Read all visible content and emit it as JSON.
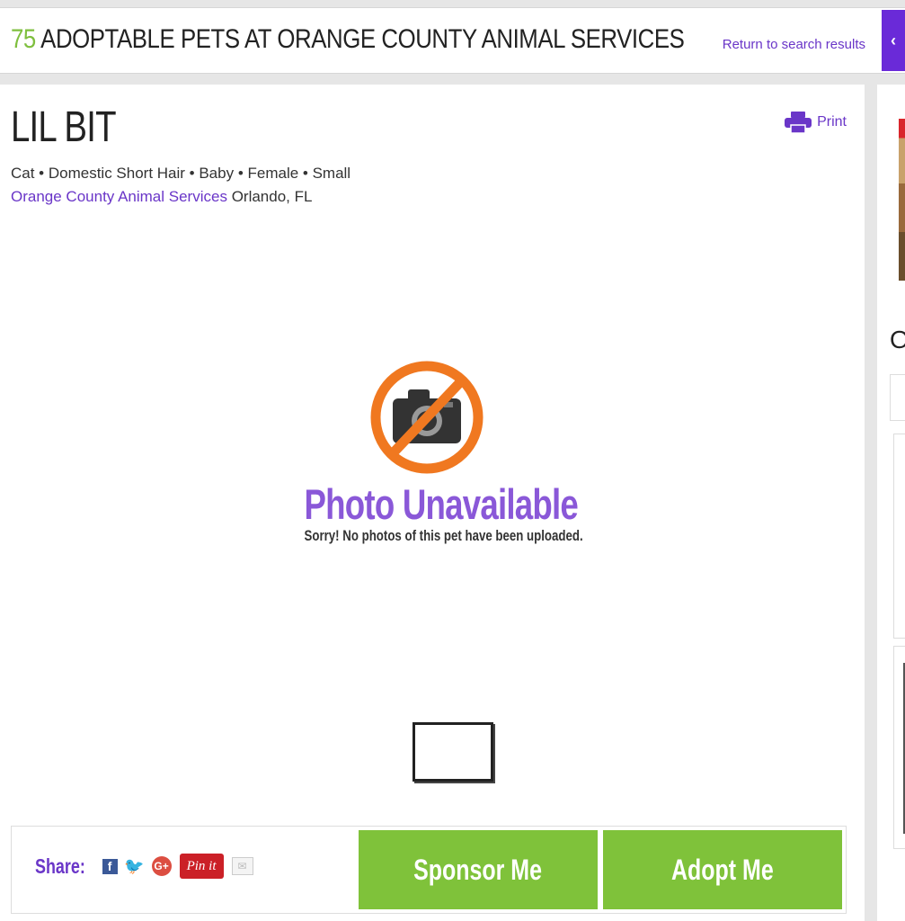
{
  "header": {
    "count": "75",
    "title": "ADOPTABLE PETS AT ORANGE COUNTY ANIMAL SERVICES",
    "return_link": "Return to search results",
    "collapse_glyph": "‹"
  },
  "pet": {
    "name": "LIL BIT",
    "details": "Cat • Domestic Short Hair • Baby • Female • Small",
    "shelter": "Orange County Animal Services",
    "location": "Orlando, FL"
  },
  "print_label": "Print",
  "photo": {
    "title": "Photo Unavailable",
    "message": "Sorry! No photos of this pet have been uploaded.",
    "icon": "no-camera-icon"
  },
  "share": {
    "label": "Share:",
    "facebook": "f",
    "twitter": "🐦",
    "google": "G+",
    "pinterest": "Pin it",
    "email": "✉"
  },
  "actions": {
    "sponsor": "Sponsor Me",
    "adopt": "Adopt Me"
  },
  "sidebar": {
    "partial_letter": "O"
  },
  "colors": {
    "accent_purple": "#6a36c8",
    "green": "#7fc23a",
    "orange": "#f07820"
  }
}
